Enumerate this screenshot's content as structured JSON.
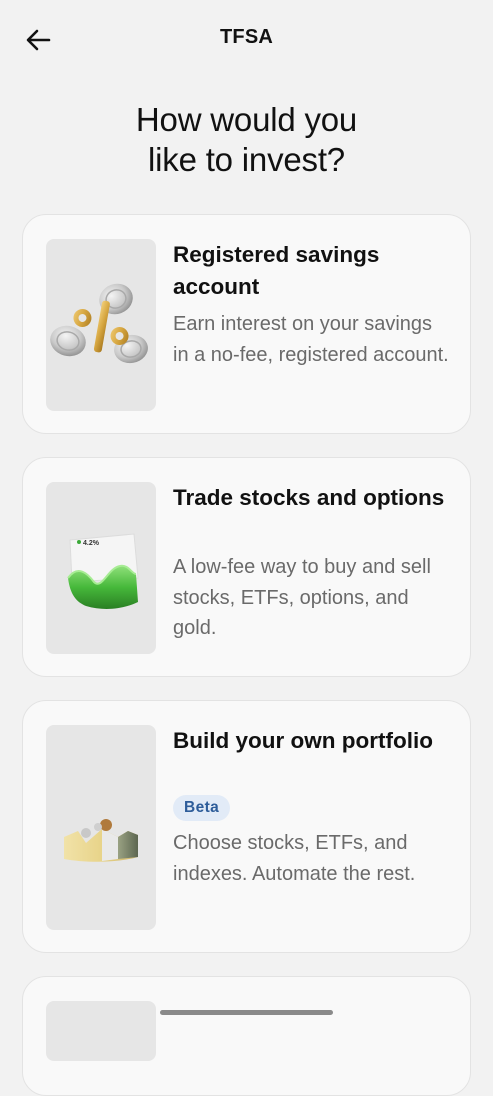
{
  "header": {
    "title": "TFSA",
    "back_icon": "arrow-left-icon"
  },
  "heading": {
    "line1": "How would you",
    "line2": "like to invest?"
  },
  "options": [
    {
      "title": "Registered savings account",
      "description": "Earn interest on your savings in a no-fee, registered account.",
      "icon": "percent-coins-illustration"
    },
    {
      "title": "Trade stocks and options",
      "description": "A low-fee way to buy and sell stocks, ETFs, options, and gold.",
      "badge_value": "4.2%",
      "icon": "stock-chart-illustration"
    },
    {
      "title": "Build your own portfolio",
      "badge": "Beta",
      "description": "Choose stocks, ETFs, and indexes. Automate the rest.",
      "icon": "portfolio-illustration"
    }
  ],
  "colors": {
    "background": "#f2f2f2",
    "card": "#f9f9f9",
    "badge_bg": "#e2ebf7",
    "badge_text": "#2e5d9a",
    "muted_text": "#6a6a6a"
  }
}
